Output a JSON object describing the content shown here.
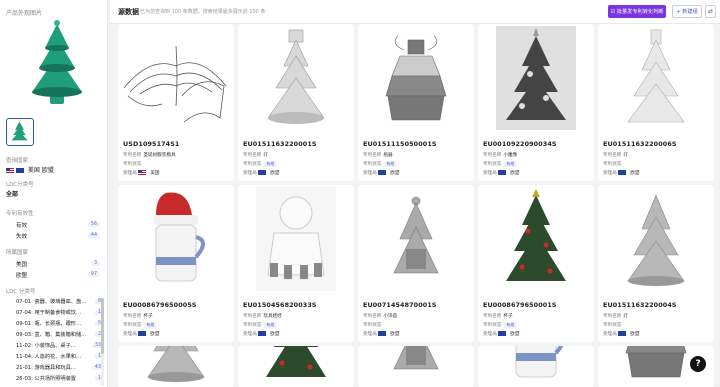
{
  "sidebar": {
    "section_title": "产品外观图片",
    "query_country_label": "查询国家",
    "query_countries": "美国 欧盟",
    "ldc_class_label": "LDC分类号",
    "ldc_class_value": "全部",
    "status_label": "专利有效性",
    "status_items": [
      {
        "label": "有效",
        "count": "56"
      },
      {
        "label": "失效",
        "count": "44"
      }
    ],
    "country_label": "所属国家",
    "country_items": [
      {
        "label": "美国",
        "count": "3"
      },
      {
        "label": "欧盟",
        "count": "97"
      }
    ],
    "ldc_label": "LDC 分类号",
    "ldc_items": [
      {
        "label": "07-01: 瓷器、玻璃器皿、盘…",
        "count": "8"
      },
      {
        "label": "07-04: 用于制备食物或饮…",
        "count": "1"
      },
      {
        "label": "09-01: 瓶、长颈瓶、跟形…",
        "count": "5"
      },
      {
        "label": "09-03: 盒、箱、集装箱和储…",
        "count": "2"
      },
      {
        "label": "11-02: 小装饰品、桌子…",
        "count": "33"
      },
      {
        "label": "11-04: 人造的花、水果和…",
        "count": "1"
      },
      {
        "label": "21-01: 游戏器具和玩具…",
        "count": "43"
      },
      {
        "label": "26-03: 公共场所照明装置",
        "count": "1"
      }
    ]
  },
  "topbar": {
    "title": "源数据",
    "subtitle": "已为您查询到 100 条数据，搜索结果最多展示前 100 条",
    "primary_button": "☑ 批量发专利转化判断",
    "secondary_button": "+ 新建组",
    "icon_button": "⇄"
  },
  "labels": {
    "name": "专利名称",
    "status": "专利状态",
    "region": "受理局"
  },
  "cards": [
    {
      "pid": "USD1095174S1",
      "name": "圣诞树服装模具",
      "status": "",
      "region": "美国",
      "flag": "us"
    },
    {
      "pid": "EU0151163220001S",
      "name": "灯",
      "status": "有效",
      "region": "欧盟",
      "flag": "eu"
    },
    {
      "pid": "EU0151115050001S",
      "name": "瓶器",
      "status": "有效",
      "region": "欧盟",
      "flag": "eu"
    },
    {
      "pid": "EU0010922090034S",
      "name": "小雕像",
      "status": "有效",
      "region": "欧盟",
      "flag": "eu"
    },
    {
      "pid": "EU0151163220006S",
      "name": "灯",
      "status": "",
      "region": "欧盟",
      "flag": "eu"
    },
    {
      "pid": "EU0008679650005S",
      "name": "杯子",
      "status": "有效",
      "region": "欧盟",
      "flag": "eu"
    },
    {
      "pid": "EU0150456820033S",
      "name": "玩具娃娃",
      "status": "有效",
      "region": "欧盟",
      "flag": "eu"
    },
    {
      "pid": "EU0071454870001S",
      "name": "小饰品",
      "status": "",
      "region": "欧盟",
      "flag": "eu"
    },
    {
      "pid": "EU0008679650001S",
      "name": "杯子",
      "status": "有效",
      "region": "欧盟",
      "flag": "eu"
    },
    {
      "pid": "EU0151163220004S",
      "name": "灯",
      "status": "",
      "region": "欧盟",
      "flag": "eu"
    }
  ],
  "colors": {
    "accent": "#7a35e0",
    "link": "#4a5fc0",
    "tree_green": "#1f9e7a"
  },
  "help_label": "?"
}
